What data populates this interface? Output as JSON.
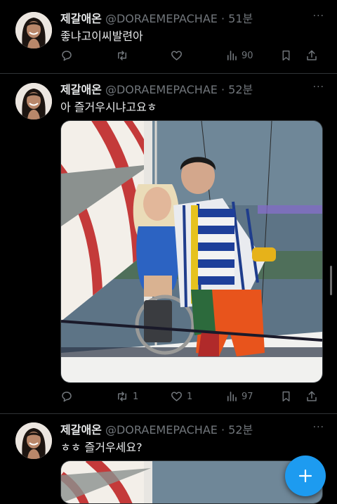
{
  "tweets": [
    {
      "name": "제갈애온",
      "handle": "@DORAEMEPACHAE",
      "dot": "·",
      "time": "51분",
      "text": "좋냐고이씨발련아",
      "replies": "",
      "retweets": "",
      "likes": "",
      "views": "90"
    },
    {
      "name": "제갈애온",
      "handle": "@DORAEMEPACHAE",
      "dot": "·",
      "time": "52분",
      "text": "아 즐거우시냐고요ㅎ",
      "replies": "",
      "retweets": "1",
      "likes": "1",
      "views": "97"
    },
    {
      "name": "제갈애온",
      "handle": "@DORAEMEPACHAE",
      "dot": "·",
      "time": "52분",
      "text": "ㅎㅎ 즐거우세요?",
      "replies": "",
      "retweets": "",
      "likes": "",
      "views": ""
    }
  ],
  "more_glyph": "···",
  "fab": {
    "label": "+",
    "color": "#1d9bf0"
  },
  "colors": {
    "background": "#000000",
    "text": "#e7e9ea",
    "muted": "#71767b",
    "accent": "#1d9bf0"
  },
  "icons": [
    "reply-icon",
    "retweet-icon",
    "like-icon",
    "views-icon",
    "bookmark-icon",
    "share-icon",
    "more-icon",
    "compose-plus-icon"
  ]
}
